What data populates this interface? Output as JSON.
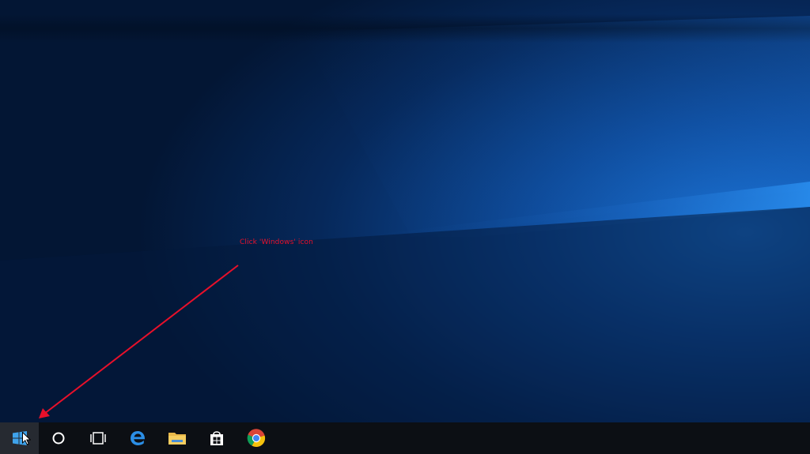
{
  "annotation": {
    "text": "Click 'Windows' icon",
    "color": "#e8102a"
  },
  "taskbar": {
    "items": [
      {
        "id": "start",
        "icon": "windows-logo-icon",
        "active": true
      },
      {
        "id": "cortana",
        "icon": "cortana-circle-icon"
      },
      {
        "id": "task-view",
        "icon": "task-view-icon"
      },
      {
        "id": "edge",
        "icon": "edge-browser-icon"
      },
      {
        "id": "file-explorer",
        "icon": "folder-icon"
      },
      {
        "id": "store",
        "icon": "store-bag-icon"
      },
      {
        "id": "chrome",
        "icon": "chrome-icon"
      }
    ]
  },
  "colors": {
    "taskbar_bg": "#0c0f14",
    "wallpaper_dark": "#041a3a",
    "wallpaper_light": "#1a73d8",
    "accent_blue": "#2b8ee6"
  }
}
